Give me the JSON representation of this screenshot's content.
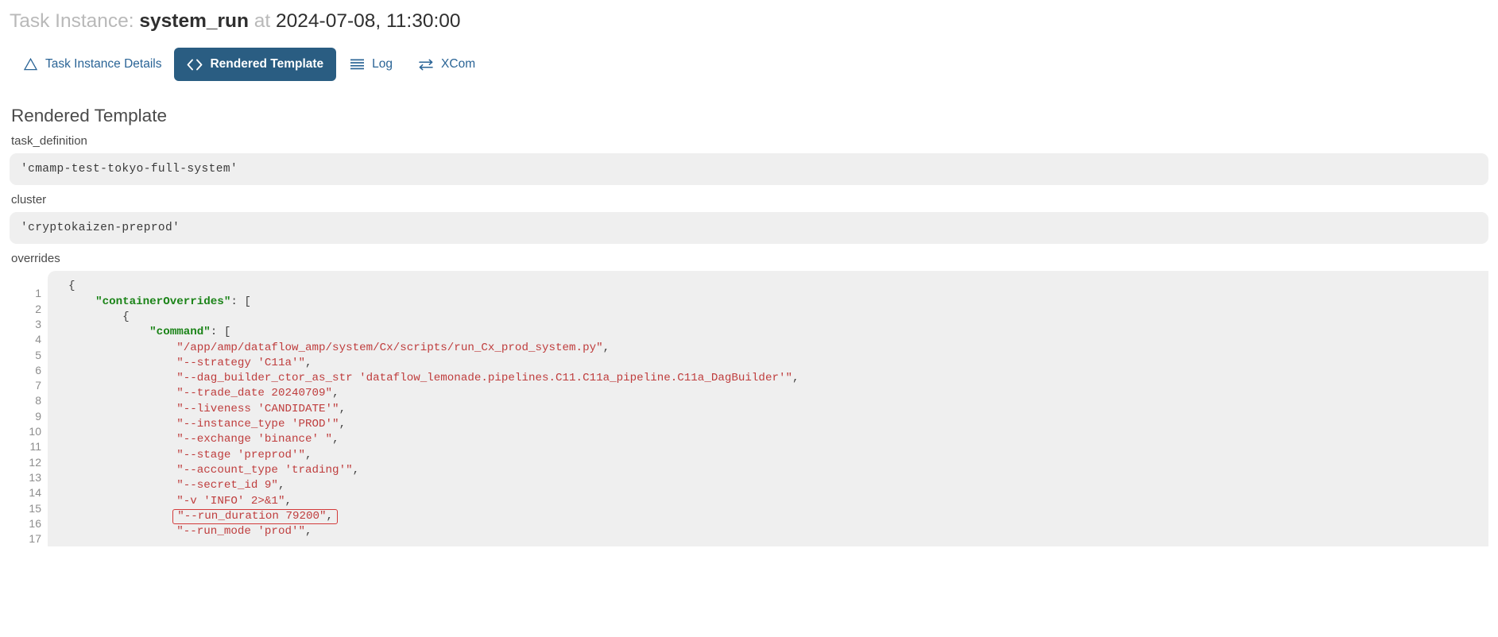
{
  "header": {
    "prefix": "Task Instance:",
    "task_id": "system_run",
    "at": "at",
    "timestamp": "2024-07-08, 11:30:00"
  },
  "tabs": [
    {
      "label": "Task Instance Details",
      "icon": "warning-triangle-icon",
      "active": false
    },
    {
      "label": "Rendered Template",
      "icon": "code-brackets-icon",
      "active": true
    },
    {
      "label": "Log",
      "icon": "list-lines-icon",
      "active": false
    },
    {
      "label": "XCom",
      "icon": "exchange-arrows-icon",
      "active": false
    }
  ],
  "section": {
    "title": "Rendered Template"
  },
  "fields": [
    {
      "label": "task_definition",
      "value": "'cmamp-test-tokyo-full-system'"
    },
    {
      "label": "cluster",
      "value": "'cryptokaizen-preprod'"
    }
  ],
  "overrides": {
    "label": "overrides",
    "line_numbers": [
      "1",
      "2",
      "3",
      "4",
      "5",
      "6",
      "7",
      "8",
      "9",
      "10",
      "11",
      "12",
      "13",
      "14",
      "15",
      "16",
      "17"
    ],
    "lines": [
      {
        "indent": 0,
        "segments": [
          {
            "t": "punct",
            "v": "{"
          }
        ]
      },
      {
        "indent": 4,
        "segments": [
          {
            "t": "key",
            "v": "\"containerOverrides\""
          },
          {
            "t": "punct",
            "v": ": ["
          }
        ]
      },
      {
        "indent": 8,
        "segments": [
          {
            "t": "punct",
            "v": "{"
          }
        ]
      },
      {
        "indent": 12,
        "segments": [
          {
            "t": "key",
            "v": "\"command\""
          },
          {
            "t": "punct",
            "v": ": ["
          }
        ]
      },
      {
        "indent": 16,
        "segments": [
          {
            "t": "str",
            "v": "\"/app/amp/dataflow_amp/system/Cx/scripts/run_Cx_prod_system.py\""
          },
          {
            "t": "punct",
            "v": ","
          }
        ]
      },
      {
        "indent": 16,
        "segments": [
          {
            "t": "str",
            "v": "\"--strategy 'C11a'\""
          },
          {
            "t": "punct",
            "v": ","
          }
        ]
      },
      {
        "indent": 16,
        "segments": [
          {
            "t": "str",
            "v": "\"--dag_builder_ctor_as_str 'dataflow_lemonade.pipelines.C11.C11a_pipeline.C11a_DagBuilder'\""
          },
          {
            "t": "punct",
            "v": ","
          }
        ]
      },
      {
        "indent": 16,
        "segments": [
          {
            "t": "str",
            "v": "\"--trade_date 20240709\""
          },
          {
            "t": "punct",
            "v": ","
          }
        ]
      },
      {
        "indent": 16,
        "segments": [
          {
            "t": "str",
            "v": "\"--liveness 'CANDIDATE'\""
          },
          {
            "t": "punct",
            "v": ","
          }
        ]
      },
      {
        "indent": 16,
        "segments": [
          {
            "t": "str",
            "v": "\"--instance_type 'PROD'\""
          },
          {
            "t": "punct",
            "v": ","
          }
        ]
      },
      {
        "indent": 16,
        "segments": [
          {
            "t": "str",
            "v": "\"--exchange 'binance' \""
          },
          {
            "t": "punct",
            "v": ","
          }
        ]
      },
      {
        "indent": 16,
        "segments": [
          {
            "t": "str",
            "v": "\"--stage 'preprod'\""
          },
          {
            "t": "punct",
            "v": ","
          }
        ]
      },
      {
        "indent": 16,
        "segments": [
          {
            "t": "str",
            "v": "\"--account_type 'trading'\""
          },
          {
            "t": "punct",
            "v": ","
          }
        ]
      },
      {
        "indent": 16,
        "segments": [
          {
            "t": "str",
            "v": "\"--secret_id 9\""
          },
          {
            "t": "punct",
            "v": ","
          }
        ]
      },
      {
        "indent": 16,
        "segments": [
          {
            "t": "str",
            "v": "\"-v 'INFO' 2>&1\""
          },
          {
            "t": "punct",
            "v": ","
          }
        ]
      },
      {
        "indent": 16,
        "highlight": true,
        "segments": [
          {
            "t": "str",
            "v": "\"--run_duration 79200\""
          },
          {
            "t": "punct",
            "v": ","
          }
        ]
      },
      {
        "indent": 16,
        "segments": [
          {
            "t": "str",
            "v": "\"--run_mode 'prod'\""
          },
          {
            "t": "punct",
            "v": ","
          }
        ]
      }
    ]
  },
  "colors": {
    "active_tab_bg": "#2a5d82",
    "link": "#2a6496",
    "code_bg": "#efefef",
    "json_key": "#1a8317",
    "json_string": "#bf3d3d",
    "highlight_border": "#d33a3a"
  }
}
